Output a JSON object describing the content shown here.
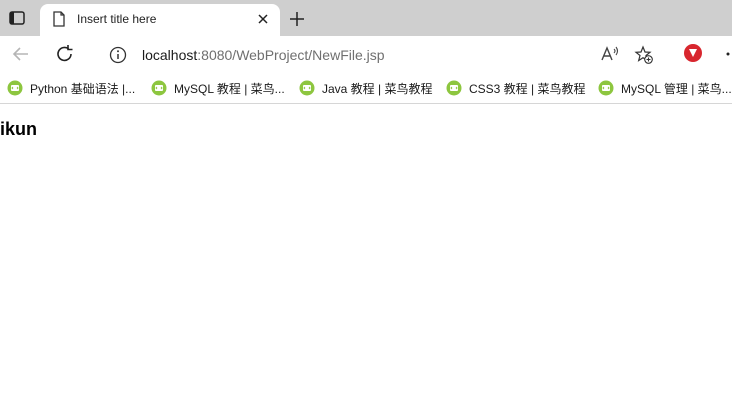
{
  "tab": {
    "title": "Insert title here"
  },
  "address_bar": {
    "url_host": "localhost",
    "url_path": ":8080/WebProject/NewFile.jsp"
  },
  "bookmarks": [
    {
      "label": "Python 基础语法 |..."
    },
    {
      "label": "MySQL 教程 | 菜鸟..."
    },
    {
      "label": "Java 教程 | 菜鸟教程"
    },
    {
      "label": "CSS3 教程 | 菜鸟教程"
    },
    {
      "label": "MySQL 管理 | 菜鸟..."
    }
  ],
  "page": {
    "heading": "ikun"
  },
  "colors": {
    "tabstrip": "#cfcfcf",
    "extension": "#d8262e",
    "bookmark_icon": "#8dc63f"
  }
}
